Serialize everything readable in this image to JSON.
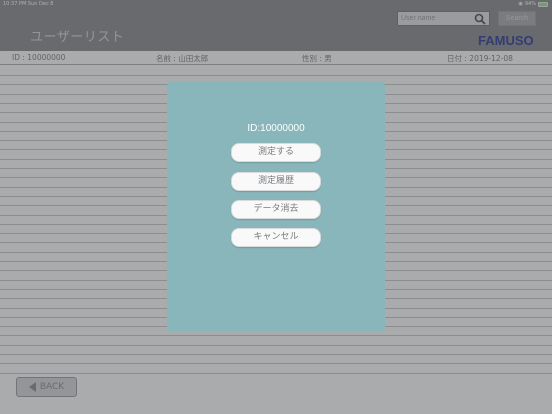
{
  "status": {
    "time": "10:37 PM",
    "date": "Sun Dec 8",
    "battery": "94%",
    "battery_level": 0.94
  },
  "header": {
    "title": "ユーザーリスト",
    "search_placeholder": "User name",
    "search_label": "Search",
    "logo_text": "FAMUSO"
  },
  "info": {
    "id": "ID : 10000000",
    "name": "名前 : 山田太郎",
    "gender": "性別 : 男",
    "date": "日付 : 2019-12-08"
  },
  "back_label": "BACK",
  "modal": {
    "id_text": "ID:10000000",
    "buttons": [
      "測定する",
      "測定履歴",
      "データ消去",
      "キャンセル"
    ]
  },
  "colors": {
    "header": "#7b7d80",
    "modal": "#88b6bb",
    "logo": "#1f2f8c"
  }
}
